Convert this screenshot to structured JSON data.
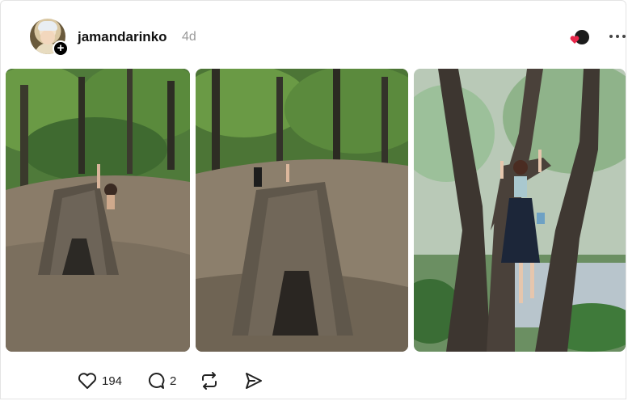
{
  "post": {
    "username": "jamandarinko",
    "time_ago": "4d",
    "likes": "194",
    "comments": "2"
  },
  "icons": {
    "avatar": "profile-photo",
    "follow": "plus-icon",
    "reactors": "reactor-avatars",
    "more": "ellipsis-icon",
    "like": "heart-icon",
    "comment": "speech-bubble-icon",
    "repost": "repost-icon",
    "share": "send-icon"
  },
  "colors": {
    "heart_red": "#e8264a",
    "muted_text": "#9a9a9a"
  }
}
